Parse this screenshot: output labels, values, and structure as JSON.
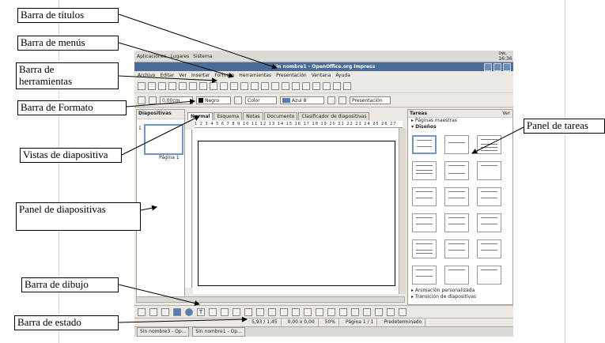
{
  "callouts": {
    "titulos": "Barra de títulos",
    "menus": "Barra de menús",
    "herramientas_l1": "Barra de",
    "herramientas_l2": "herramientas",
    "formato": "Barra de Formato",
    "vistas": "Vistas de diapositiva",
    "panel_diap": "Panel de diapositivas",
    "dibujo": "Barra de dibujo",
    "estado": "Barra de estado",
    "tareas": "Panel de tareas"
  },
  "screen": {
    "gnome_panel": {
      "items": [
        "Aplicaciones",
        "Lugares",
        "Sistema"
      ],
      "clock": "ow, 16:36"
    },
    "window_title": "Sin nombre1 - OpenOffice.org Impress",
    "menu": [
      "Archivo",
      "Editar",
      "Ver",
      "Insertar",
      "Formato",
      "Herramientas",
      "Presentación",
      "Ventana",
      "Ayuda"
    ],
    "format_bar": {
      "line_width": "0,00cm",
      "line_color": "Negro",
      "fill_mode": "Color",
      "fill_color": "Azul 8",
      "presentation_btn": "Presentación"
    },
    "slides_pane": {
      "title": "Diapositivas",
      "thumb_number": "1",
      "thumb_label": "Página 1"
    },
    "view_tabs": [
      "Normal",
      "Esquema",
      "Notas",
      "Documento",
      "Clasificador de diapositivas"
    ],
    "ruler_numbers": "1 2 3 4 5 6 7 8 9 10 11 12 13 14 15 16 17 18 19 20 21 22 23 24 25 26 27 28",
    "task_pane": {
      "title": "Tareas",
      "view": "Ver",
      "sections": [
        "Páginas maestras",
        "Diseños"
      ],
      "bottom_sections": [
        "Animación personalizada",
        "Transición de diapositivas"
      ]
    },
    "status_bar": {
      "position": "5,93 / 1,45",
      "size": "0,00 x 0,00",
      "zoom": "50%",
      "page": "Página 1 / 1",
      "master": "Predeterminado"
    },
    "taskbar": [
      "Sin nombre3 - Op...",
      "Sin nombre1 - Op..."
    ]
  }
}
